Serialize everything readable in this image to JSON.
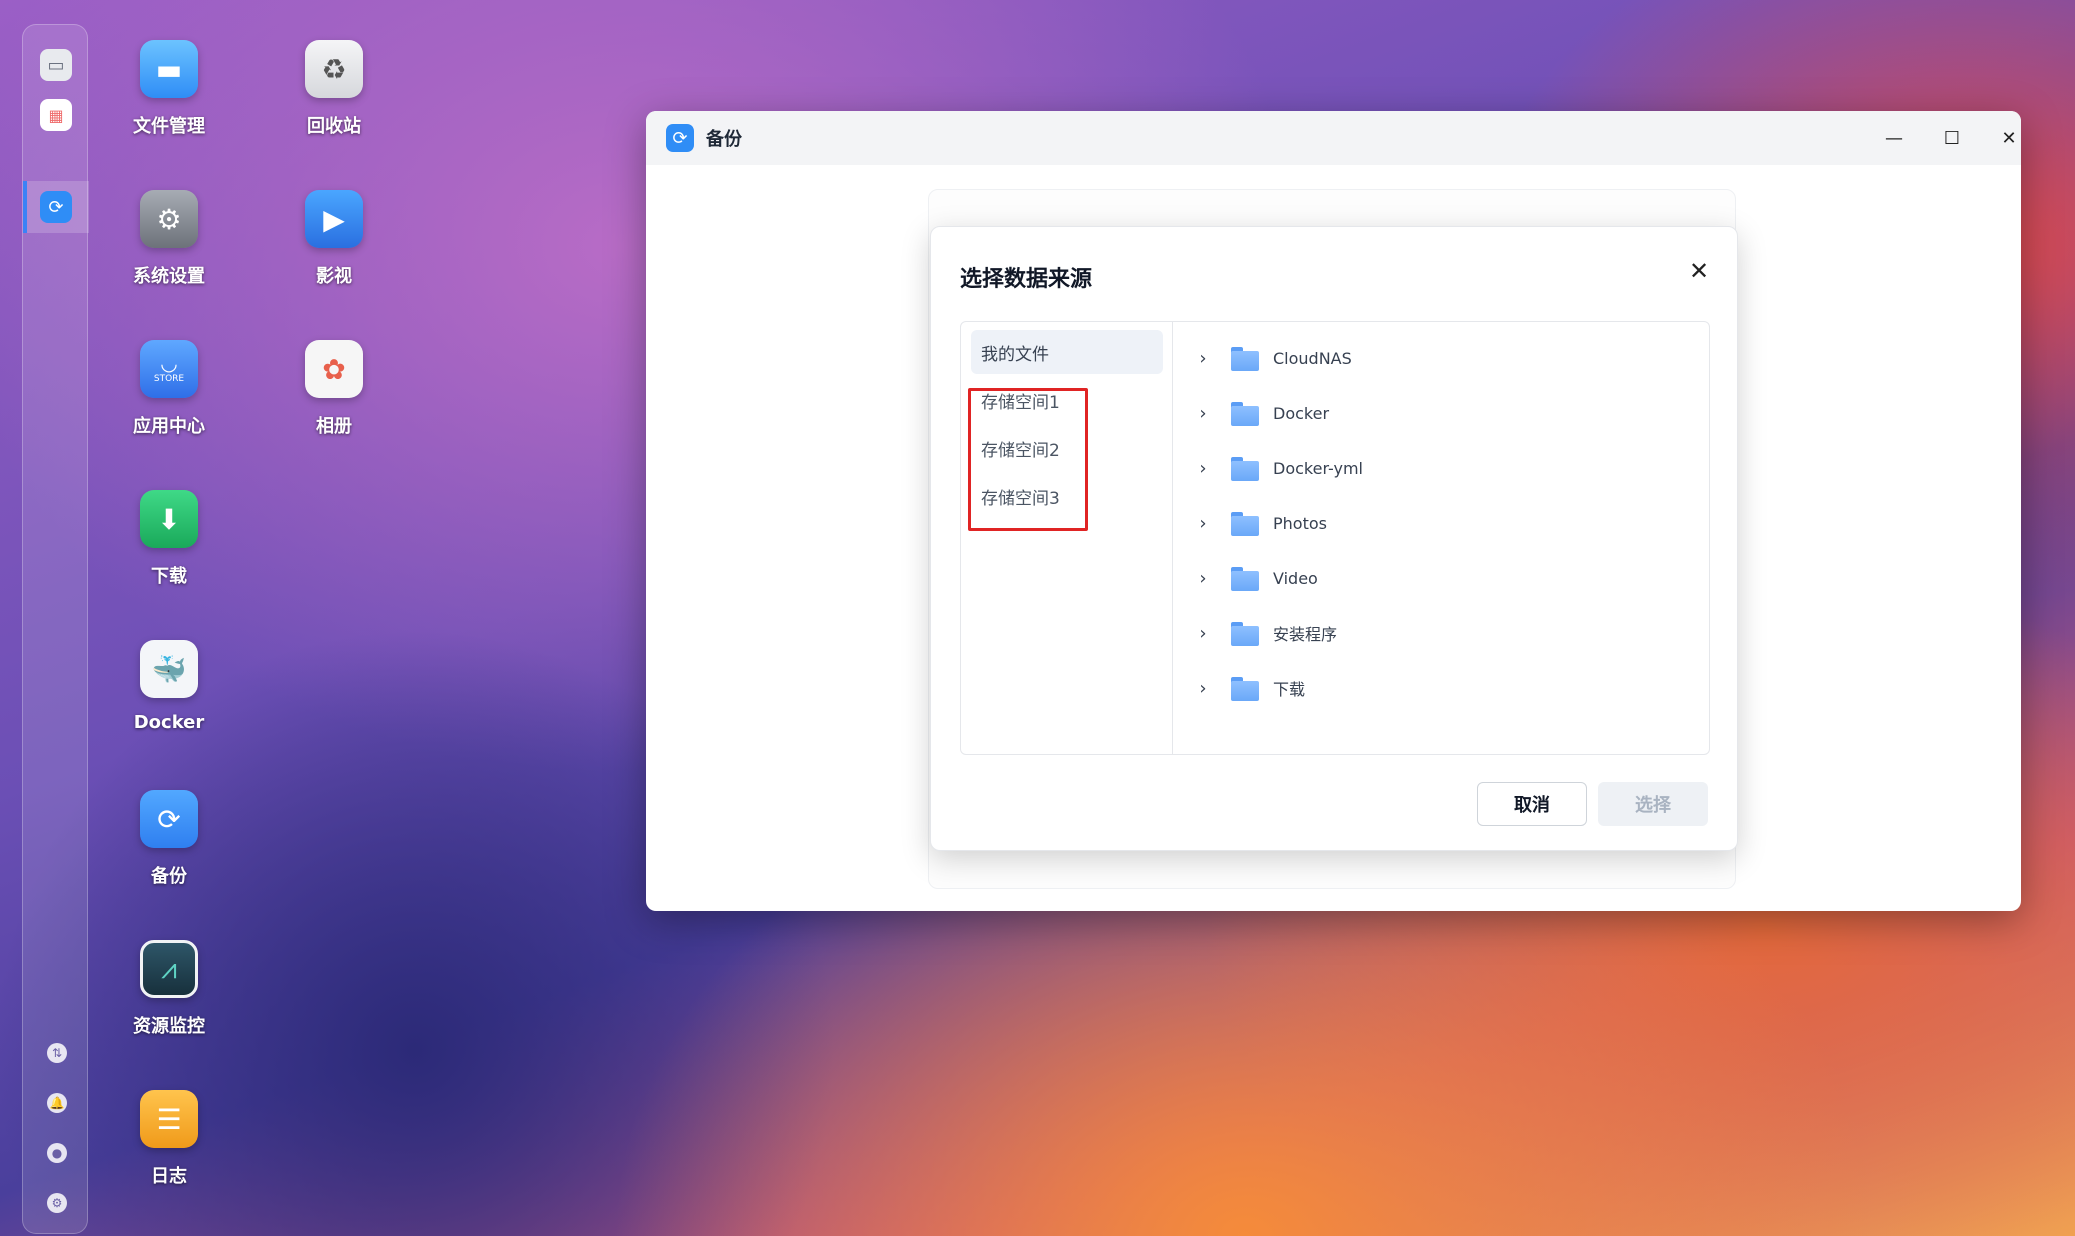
{
  "desktop": {
    "icons": [
      {
        "name": "file-manager",
        "label": "文件管理",
        "icon": "folder-icon",
        "color": "#3a9bf5"
      },
      {
        "name": "recycle-bin",
        "label": "回收站",
        "icon": "recycle-icon",
        "color": "#e8e8ea"
      },
      {
        "name": "system-settings",
        "label": "系统设置",
        "icon": "gear-icon",
        "color": "#8a8f98"
      },
      {
        "name": "video",
        "label": "影视",
        "icon": "video-icon",
        "color": "#2f8df6"
      },
      {
        "name": "app-center",
        "label": "应用中心",
        "icon": "store-icon",
        "color": "#2f7ff0"
      },
      {
        "name": "photos",
        "label": "相册",
        "icon": "photos-icon",
        "color": "#f2f2f2"
      },
      {
        "name": "download",
        "label": "下载",
        "icon": "download-icon",
        "color": "#22c06a"
      },
      {
        "name": "docker",
        "label": "Docker",
        "icon": "docker-icon",
        "color": "#f2f4f7"
      },
      {
        "name": "backup",
        "label": "备份",
        "icon": "backup-icon",
        "color": "#2f8df6"
      },
      {
        "name": "resource-monitor",
        "label": "资源监控",
        "icon": "monitor-icon",
        "color": "#1f3a4a"
      },
      {
        "name": "logs",
        "label": "日志",
        "icon": "log-icon",
        "color": "#f5a623"
      }
    ],
    "store_text": "STORE"
  },
  "window": {
    "title": "备份",
    "controls": {
      "minimize": "—",
      "maximize": "☐",
      "close": "✕"
    }
  },
  "dialog": {
    "title": "选择数据来源",
    "close": "✕",
    "sources": [
      "我的文件",
      "存储空间1",
      "存储空间2",
      "存储空间3"
    ],
    "selected_source": "我的文件",
    "folders": [
      "CloudNAS",
      "Docker",
      "Docker-yml",
      "Photos",
      "Video",
      "安装程序",
      "下载"
    ],
    "cancel_label": "取消",
    "select_label": "选择"
  }
}
